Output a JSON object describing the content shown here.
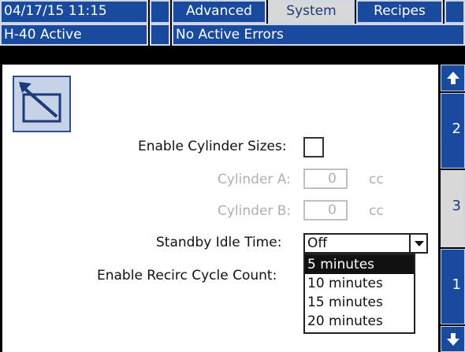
{
  "header": {
    "datetime": "04/17/15 11:15",
    "tabs": [
      {
        "label": "Advanced",
        "active": false
      },
      {
        "label": "System",
        "active": true
      },
      {
        "label": "Recipes",
        "active": false
      }
    ],
    "status_left": "H-40 Active",
    "status_right": "No Active Errors"
  },
  "form": {
    "enable_cylinder_label": "Enable Cylinder Sizes:",
    "cylinder_a_label": "Cylinder A:",
    "cylinder_a_value": "0",
    "cylinder_a_unit": "cc",
    "cylinder_b_label": "Cylinder B:",
    "cylinder_b_value": "0",
    "cylinder_b_unit": "cc",
    "standby_label": "Standby Idle Time:",
    "standby_value": "Off",
    "recirc_label": "Enable Recirc Cycle Count:",
    "dropdown_options": [
      "5 minutes",
      "10 minutes",
      "15 minutes",
      "20 minutes"
    ],
    "dropdown_highlighted": "5 minutes"
  },
  "sidebar": {
    "pages": [
      "2",
      "3",
      "1"
    ],
    "active_page": "3"
  },
  "colors": {
    "blue": "#1a4a9e",
    "gray": "#d8d8d8",
    "background": "#000000"
  }
}
